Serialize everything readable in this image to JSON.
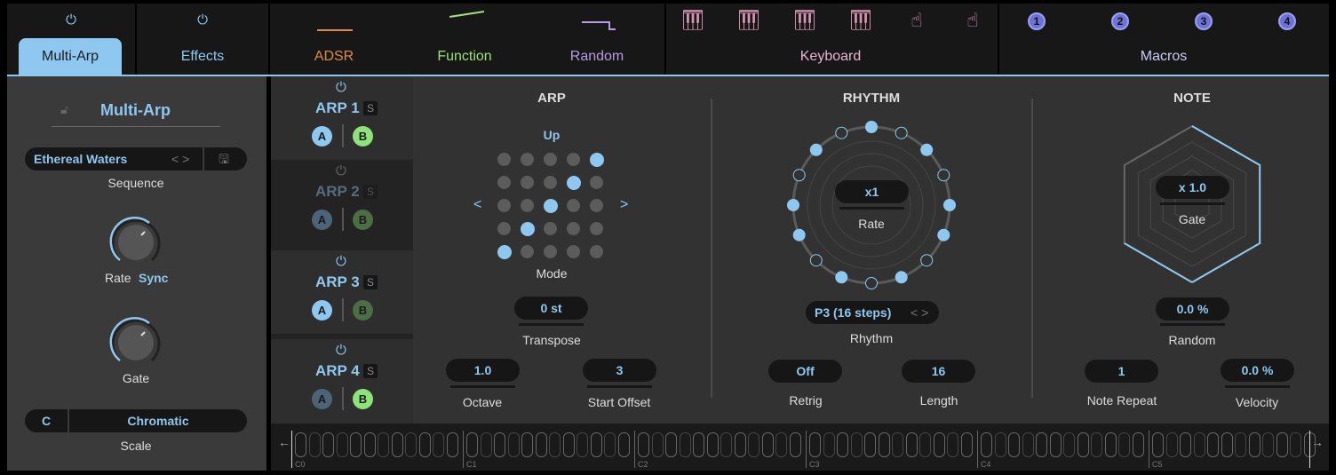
{
  "tabs": [
    {
      "label": "Multi-Arp",
      "color": "#1c1c1c"
    },
    {
      "label": "Effects",
      "color": "#8ec7ef"
    },
    {
      "label": "ADSR",
      "color": "#e0864f"
    },
    {
      "label": "Function",
      "color": "#9ee27a"
    },
    {
      "label": "Random",
      "color": "#b79be6"
    },
    {
      "label": "Keyboard",
      "color": "#e8b5cf"
    },
    {
      "label": "Macros",
      "color": "#c9cdf5"
    }
  ],
  "macros": [
    "1",
    "2",
    "3",
    "4"
  ],
  "left": {
    "title": "Multi-Arp",
    "sequence_value": "Ethereal Waters",
    "sequence_label": "Sequence",
    "rate_label": "Rate",
    "rate_mode": "Sync",
    "gate_label": "Gate",
    "scale_root": "C",
    "scale_value": "Chromatic",
    "scale_label": "Scale"
  },
  "arps": [
    {
      "name": "ARP 1",
      "solo": "S",
      "a": "A",
      "b": "B"
    },
    {
      "name": "ARP 2",
      "solo": "S",
      "a": "A",
      "b": "B"
    },
    {
      "name": "ARP 3",
      "solo": "S",
      "a": "A",
      "b": "B"
    },
    {
      "name": "ARP 4",
      "solo": "S",
      "a": "A",
      "b": "B"
    }
  ],
  "arp": {
    "header": "ARP",
    "mode_value": "Up",
    "mode_label": "Mode",
    "mode_grid_active": [
      4,
      3,
      2,
      1,
      0
    ],
    "transpose": "0 st",
    "transpose_label": "Transpose",
    "octave": "1.0",
    "octave_label": "Octave",
    "start_offset": "3",
    "start_offset_label": "Start Offset"
  },
  "rhythm": {
    "header": "RHYTHM",
    "rate": "x1",
    "rate_label": "Rate",
    "pattern": "P3 (16 steps)",
    "pattern_label": "Rhythm",
    "steps": [
      1,
      0,
      1,
      0,
      1,
      1,
      0,
      1,
      0,
      1,
      0,
      1,
      1,
      0,
      1,
      0
    ],
    "retrig": "Off",
    "retrig_label": "Retrig",
    "length": "16",
    "length_label": "Length"
  },
  "note": {
    "header": "NOTE",
    "gate": "x 1.0",
    "gate_label": "Gate",
    "random": "0.0 %",
    "random_label": "Random",
    "note_repeat": "1",
    "note_repeat_label": "Note Repeat",
    "velocity": "0.0 %",
    "velocity_label": "Velocity"
  },
  "keyboard": {
    "octaves": [
      "C0",
      "C1",
      "C2",
      "C3",
      "C4",
      "C5"
    ]
  },
  "colors": {
    "accent": "#8ec7ef",
    "green": "#8ee27a"
  }
}
